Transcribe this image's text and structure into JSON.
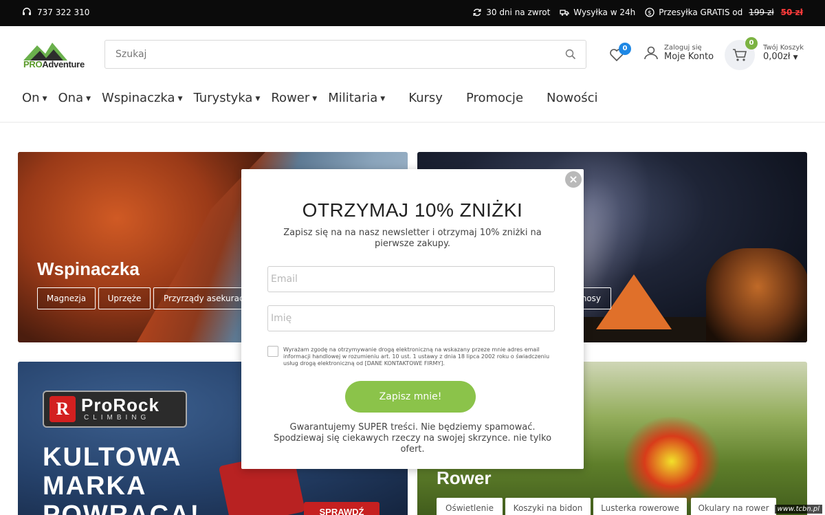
{
  "topbar": {
    "phone": "737 322 310",
    "returns": "30 dni na zwrot",
    "shipping": "Wysyłka w 24h",
    "free_shipping": "Przesyłka GRATIS od",
    "free_from": "199 zł",
    "free_price": "50 zł"
  },
  "header": {
    "logo_pro": "PRO",
    "logo_rest": "Adventure",
    "search_placeholder": "Szukaj",
    "wishlist_count": "0",
    "account_small": "Zaloguj się",
    "account_big": "Moje Konto",
    "cart_count": "0",
    "cart_small": "Twój Koszyk",
    "cart_total": "0,00zł"
  },
  "nav": {
    "dropdowns": [
      "On",
      "Ona",
      "Wspinaczka",
      "Turystyka",
      "Rower",
      "Militaria"
    ],
    "links": [
      "Kursy",
      "Promocje",
      "Nowości"
    ]
  },
  "banners": {
    "climbing": {
      "title": "Wspinaczka",
      "tags": [
        "Magnezja",
        "Uprzęże",
        "Przyrządy asekuracyjne"
      ]
    },
    "tourism": {
      "tag": "nosy"
    },
    "prorock": {
      "logo_mark": "R",
      "logo_line1": "ProRock",
      "logo_line2": "CLIMBING",
      "headline1": "KULTOWA",
      "headline2": "MARKA",
      "headline3": "POWRACA!",
      "button": "SPRAWDŹ"
    },
    "bike": {
      "title": "Rower",
      "tags": [
        "Oświetlenie",
        "Koszyki na bidon",
        "Lusterka rowerowe",
        "Okulary na rower"
      ]
    }
  },
  "modal": {
    "title": "OTRZYMAJ 10% ZNIŻKI",
    "subtitle": "Zapisz się na na nasz newsletter i otrzymaj 10% zniżki na pierwsze zakupy.",
    "email_placeholder": "Email",
    "name_placeholder": "Imię",
    "consent": "Wyrażam zgodę na otrzymywanie drogą elektroniczną na wskazany przeze mnie adres email informacji handlowej w rozumieniu art. 10 ust. 1 ustawy z dnia 18 lipca 2002 roku o świadczeniu usług drogą elektroniczną od [DANE KONTAKTOWE FIRMY].",
    "submit": "Zapisz mnie!",
    "footer": "Gwarantujemy SUPER treści. Nie będziemy spamować. Spodziewaj się ciekawych rzeczy na swojej skrzynce. nie tylko ofert.",
    "close": "×"
  },
  "watermark": "www.tcbn.pl",
  "colors": {
    "accent_green": "#8bc34a",
    "badge_blue": "#1e88e5",
    "badge_green": "#7cb342",
    "price_red": "#ff3b3b"
  },
  "icons": [
    "headset-icon",
    "refresh-icon",
    "truck-icon",
    "dollar-icon",
    "search-icon",
    "heart-icon",
    "user-icon",
    "cart-icon",
    "close-icon",
    "caret-down-icon"
  ]
}
